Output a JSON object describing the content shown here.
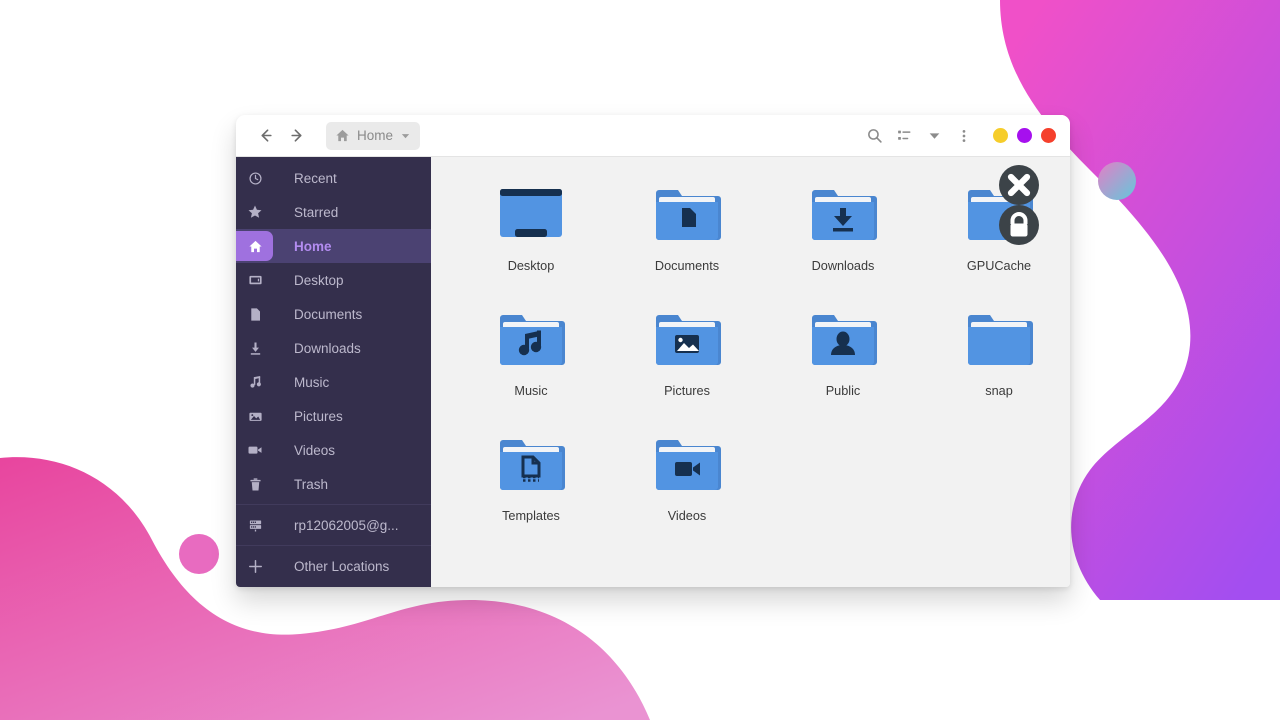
{
  "background": {
    "base_color": "#ffffff",
    "blob_top_right": {
      "name": "pink-purple-blob",
      "from": "#f050c8",
      "to": "#a34ef0"
    },
    "blob_bottom_left": {
      "name": "pink-blob",
      "from": "#e8459e",
      "to": "#e98fd0"
    },
    "circle_right": {
      "name": "gradient-circle-right",
      "from": "#e07ec8",
      "to": "#6fc9d8"
    },
    "circle_left": {
      "name": "pink-circle-left",
      "color": "#e86bc0"
    }
  },
  "window": {
    "header": {
      "back_icon": "back-arrow-icon",
      "forward_icon": "forward-arrow-icon",
      "path_home_icon": "home-icon",
      "path_label": "Home",
      "path_dropdown_icon": "chevron-down-icon",
      "search_icon": "search-icon",
      "list_view_icon": "list-view-icon",
      "view_dropdown_icon": "caret-down-icon",
      "menu_icon": "overflow-menu-icon",
      "controls": [
        {
          "name": "minimize-button",
          "color": "#f6cd2b"
        },
        {
          "name": "maximize-button",
          "color": "#a610ee"
        },
        {
          "name": "close-button",
          "color": "#f5402c"
        }
      ]
    },
    "sidebar": {
      "items": [
        {
          "label": "Recent",
          "icon": "clock-icon",
          "selected": false
        },
        {
          "label": "Starred",
          "icon": "star-icon",
          "selected": false
        },
        {
          "label": "Home",
          "icon": "home-icon",
          "selected": true
        },
        {
          "label": "Desktop",
          "icon": "desktop-icon",
          "selected": false
        },
        {
          "label": "Documents",
          "icon": "document-icon",
          "selected": false
        },
        {
          "label": "Downloads",
          "icon": "download-icon",
          "selected": false
        },
        {
          "label": "Music",
          "icon": "music-note-icon",
          "selected": false
        },
        {
          "label": "Pictures",
          "icon": "image-icon",
          "selected": false
        },
        {
          "label": "Videos",
          "icon": "video-camera-icon",
          "selected": false
        },
        {
          "label": "Trash",
          "icon": "trash-icon",
          "selected": false
        }
      ],
      "network": {
        "label": "rp12062005@g...",
        "icon": "server-icon"
      },
      "other": {
        "label": "Other Locations",
        "icon": "plus-icon"
      }
    },
    "files": [
      {
        "name": "Desktop",
        "icon": "desktop-folder-icon",
        "glyph": "desktop",
        "badges": []
      },
      {
        "name": "Documents",
        "icon": "documents-folder-icon",
        "glyph": "document",
        "badges": []
      },
      {
        "name": "Downloads",
        "icon": "downloads-folder-icon",
        "glyph": "download",
        "badges": []
      },
      {
        "name": "GPUCache",
        "icon": "folder-icon",
        "glyph": "none",
        "badges": [
          "x-badge-icon",
          "lock-badge-icon"
        ]
      },
      {
        "name": "Music",
        "icon": "music-folder-icon",
        "glyph": "music",
        "badges": []
      },
      {
        "name": "Pictures",
        "icon": "pictures-folder-icon",
        "glyph": "image",
        "badges": []
      },
      {
        "name": "Public",
        "icon": "public-folder-icon",
        "glyph": "person",
        "badges": []
      },
      {
        "name": "snap",
        "icon": "folder-icon",
        "glyph": "none",
        "badges": []
      },
      {
        "name": "Templates",
        "icon": "templates-folder-icon",
        "glyph": "template",
        "badges": []
      },
      {
        "name": "Videos",
        "icon": "videos-folder-icon",
        "glyph": "video",
        "badges": []
      }
    ],
    "colors": {
      "sidebar_bg": "#342f4c",
      "sidebar_selected_bg": "#4b4272",
      "sidebar_selected_text": "#b38cf0",
      "sidebar_pill": "#9f71df",
      "content_bg": "#f2f2f2",
      "folder_blue": "#5294e2",
      "folder_dark": "#16304f"
    }
  }
}
